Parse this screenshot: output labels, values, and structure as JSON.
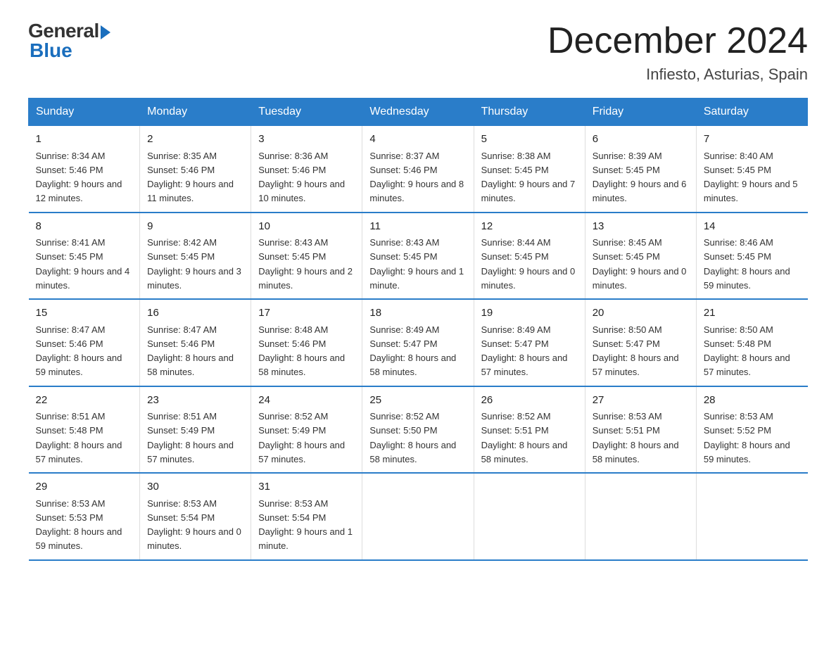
{
  "logo": {
    "general": "General",
    "blue": "Blue"
  },
  "title": "December 2024",
  "subtitle": "Infiesto, Asturias, Spain",
  "days_of_week": [
    "Sunday",
    "Monday",
    "Tuesday",
    "Wednesday",
    "Thursday",
    "Friday",
    "Saturday"
  ],
  "weeks": [
    [
      {
        "num": "1",
        "sunrise": "8:34 AM",
        "sunset": "5:46 PM",
        "daylight": "9 hours and 12 minutes."
      },
      {
        "num": "2",
        "sunrise": "8:35 AM",
        "sunset": "5:46 PM",
        "daylight": "9 hours and 11 minutes."
      },
      {
        "num": "3",
        "sunrise": "8:36 AM",
        "sunset": "5:46 PM",
        "daylight": "9 hours and 10 minutes."
      },
      {
        "num": "4",
        "sunrise": "8:37 AM",
        "sunset": "5:46 PM",
        "daylight": "9 hours and 8 minutes."
      },
      {
        "num": "5",
        "sunrise": "8:38 AM",
        "sunset": "5:45 PM",
        "daylight": "9 hours and 7 minutes."
      },
      {
        "num": "6",
        "sunrise": "8:39 AM",
        "sunset": "5:45 PM",
        "daylight": "9 hours and 6 minutes."
      },
      {
        "num": "7",
        "sunrise": "8:40 AM",
        "sunset": "5:45 PM",
        "daylight": "9 hours and 5 minutes."
      }
    ],
    [
      {
        "num": "8",
        "sunrise": "8:41 AM",
        "sunset": "5:45 PM",
        "daylight": "9 hours and 4 minutes."
      },
      {
        "num": "9",
        "sunrise": "8:42 AM",
        "sunset": "5:45 PM",
        "daylight": "9 hours and 3 minutes."
      },
      {
        "num": "10",
        "sunrise": "8:43 AM",
        "sunset": "5:45 PM",
        "daylight": "9 hours and 2 minutes."
      },
      {
        "num": "11",
        "sunrise": "8:43 AM",
        "sunset": "5:45 PM",
        "daylight": "9 hours and 1 minute."
      },
      {
        "num": "12",
        "sunrise": "8:44 AM",
        "sunset": "5:45 PM",
        "daylight": "9 hours and 0 minutes."
      },
      {
        "num": "13",
        "sunrise": "8:45 AM",
        "sunset": "5:45 PM",
        "daylight": "9 hours and 0 minutes."
      },
      {
        "num": "14",
        "sunrise": "8:46 AM",
        "sunset": "5:45 PM",
        "daylight": "8 hours and 59 minutes."
      }
    ],
    [
      {
        "num": "15",
        "sunrise": "8:47 AM",
        "sunset": "5:46 PM",
        "daylight": "8 hours and 59 minutes."
      },
      {
        "num": "16",
        "sunrise": "8:47 AM",
        "sunset": "5:46 PM",
        "daylight": "8 hours and 58 minutes."
      },
      {
        "num": "17",
        "sunrise": "8:48 AM",
        "sunset": "5:46 PM",
        "daylight": "8 hours and 58 minutes."
      },
      {
        "num": "18",
        "sunrise": "8:49 AM",
        "sunset": "5:47 PM",
        "daylight": "8 hours and 58 minutes."
      },
      {
        "num": "19",
        "sunrise": "8:49 AM",
        "sunset": "5:47 PM",
        "daylight": "8 hours and 57 minutes."
      },
      {
        "num": "20",
        "sunrise": "8:50 AM",
        "sunset": "5:47 PM",
        "daylight": "8 hours and 57 minutes."
      },
      {
        "num": "21",
        "sunrise": "8:50 AM",
        "sunset": "5:48 PM",
        "daylight": "8 hours and 57 minutes."
      }
    ],
    [
      {
        "num": "22",
        "sunrise": "8:51 AM",
        "sunset": "5:48 PM",
        "daylight": "8 hours and 57 minutes."
      },
      {
        "num": "23",
        "sunrise": "8:51 AM",
        "sunset": "5:49 PM",
        "daylight": "8 hours and 57 minutes."
      },
      {
        "num": "24",
        "sunrise": "8:52 AM",
        "sunset": "5:49 PM",
        "daylight": "8 hours and 57 minutes."
      },
      {
        "num": "25",
        "sunrise": "8:52 AM",
        "sunset": "5:50 PM",
        "daylight": "8 hours and 58 minutes."
      },
      {
        "num": "26",
        "sunrise": "8:52 AM",
        "sunset": "5:51 PM",
        "daylight": "8 hours and 58 minutes."
      },
      {
        "num": "27",
        "sunrise": "8:53 AM",
        "sunset": "5:51 PM",
        "daylight": "8 hours and 58 minutes."
      },
      {
        "num": "28",
        "sunrise": "8:53 AM",
        "sunset": "5:52 PM",
        "daylight": "8 hours and 59 minutes."
      }
    ],
    [
      {
        "num": "29",
        "sunrise": "8:53 AM",
        "sunset": "5:53 PM",
        "daylight": "8 hours and 59 minutes."
      },
      {
        "num": "30",
        "sunrise": "8:53 AM",
        "sunset": "5:54 PM",
        "daylight": "9 hours and 0 minutes."
      },
      {
        "num": "31",
        "sunrise": "8:53 AM",
        "sunset": "5:54 PM",
        "daylight": "9 hours and 1 minute."
      },
      null,
      null,
      null,
      null
    ]
  ],
  "labels": {
    "sunrise": "Sunrise:",
    "sunset": "Sunset:",
    "daylight": "Daylight:"
  }
}
